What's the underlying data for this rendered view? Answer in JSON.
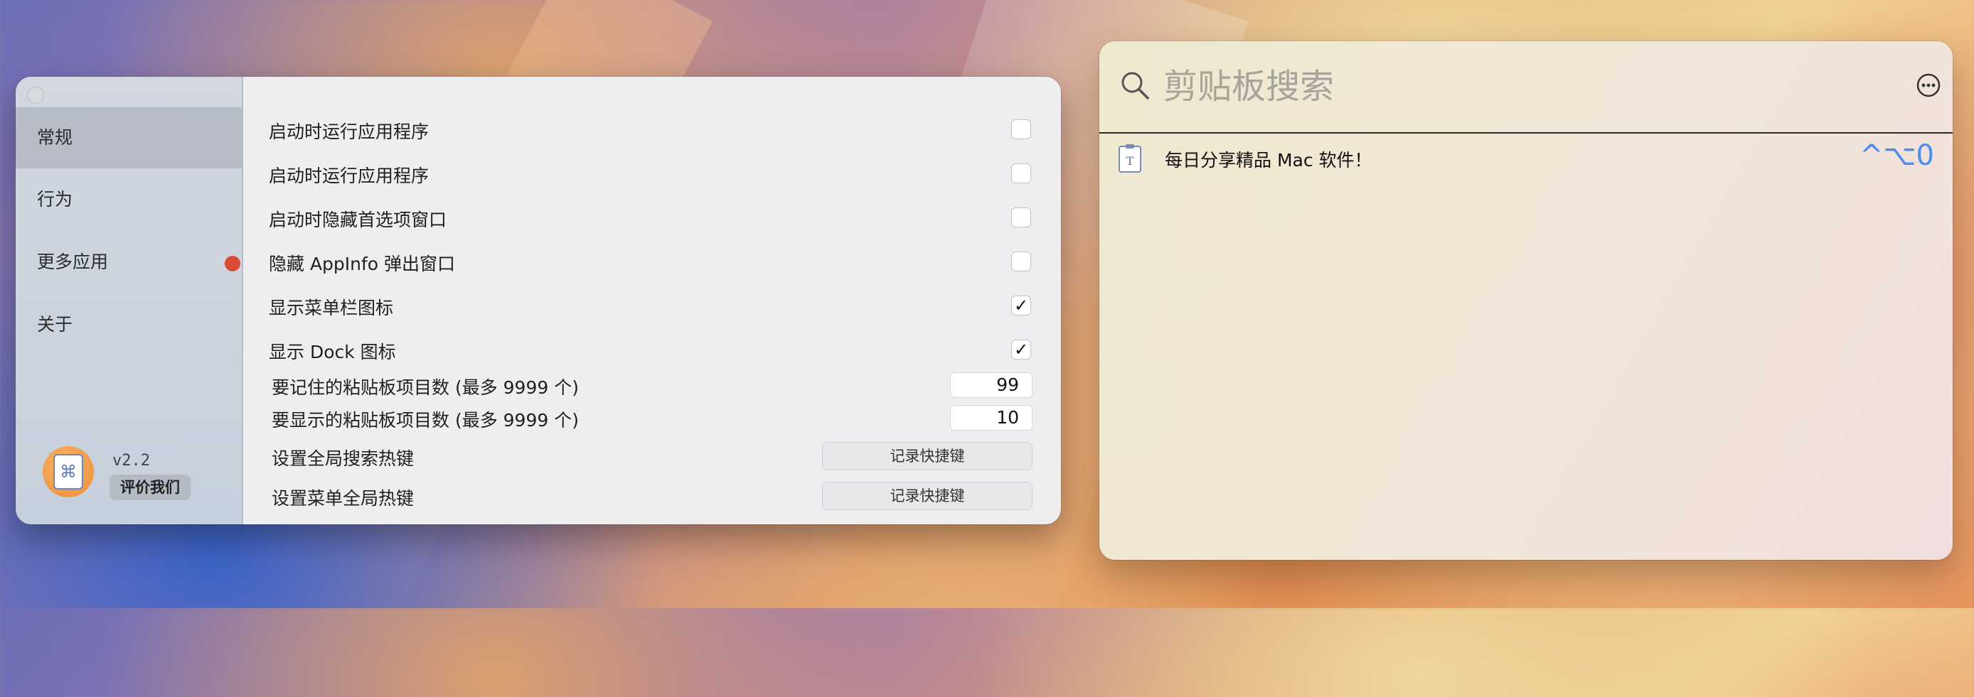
{
  "prefs": {
    "sidebar": {
      "items": [
        {
          "label": "常规",
          "active": true
        },
        {
          "label": "行为",
          "active": false
        },
        {
          "label": "更多应用",
          "active": false,
          "badge": true
        },
        {
          "label": "关于",
          "active": false
        }
      ],
      "version": "v2.2",
      "rate_label": "评价我们"
    },
    "settings": {
      "launch_at_login_1": {
        "label": "启动时运行应用程序",
        "checked": false
      },
      "launch_at_login_2": {
        "label": "启动时运行应用程序",
        "checked": false
      },
      "hide_prefs_on_launch": {
        "label": "启动时隐藏首选项窗口",
        "checked": false
      },
      "hide_appinfo_popup": {
        "label": "隐藏 AppInfo 弹出窗口",
        "checked": false
      },
      "show_menubar_icon": {
        "label": "显示菜单栏图标",
        "checked": true
      },
      "show_dock_icon": {
        "label": "显示 Dock 图标",
        "checked": true
      },
      "remember_count": {
        "label": "要记住的粘贴板项目数 (最多 9999 个)",
        "value": "99"
      },
      "display_count": {
        "label": "要显示的粘贴板项目数 (最多 9999 个)",
        "value": "10"
      },
      "global_search_hotkey": {
        "label": "设置全局搜索热键",
        "button": "记录快捷键"
      },
      "menu_global_hotkey": {
        "label": "设置菜单全局热键",
        "button": "记录快捷键"
      }
    },
    "check_mark": "✓"
  },
  "clipboard": {
    "search_placeholder": "剪贴板搜索",
    "items": [
      {
        "text": "每日分享精品 Mac 软件！",
        "shortcut": "^⌥0",
        "icon": "text-document-icon"
      }
    ]
  },
  "colors": {
    "accent_blue": "#4a8df0",
    "badge_red": "#d94a35"
  }
}
